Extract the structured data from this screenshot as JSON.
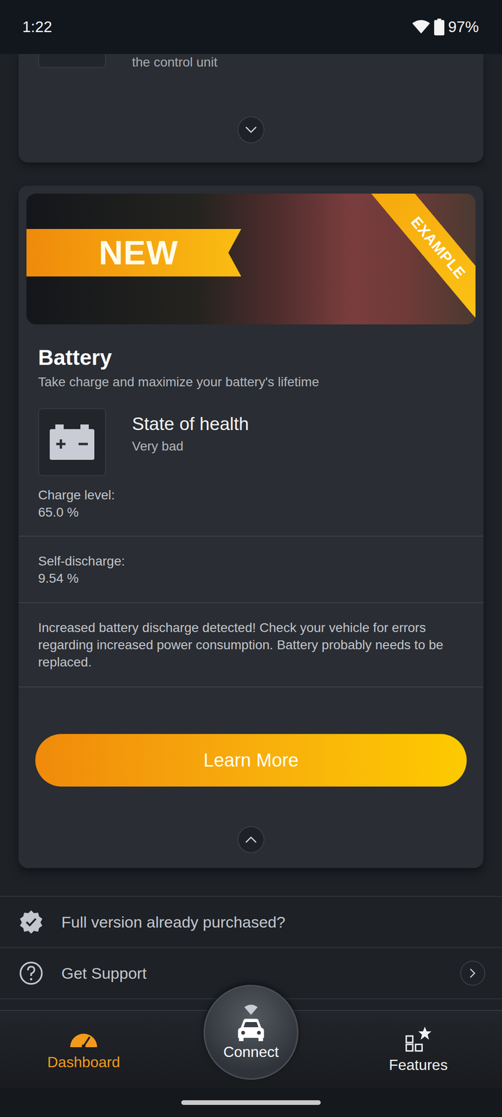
{
  "status_bar": {
    "time": "1:22",
    "battery": "97%",
    "battery_level": 0.97
  },
  "previous_card": {
    "text": "the control unit",
    "expanded": false
  },
  "battery_card": {
    "banner_badge": "NEW",
    "banner_corner": "EXAMPLE",
    "title": "Battery",
    "subtitle": "Take charge and maximize your battery's lifetime",
    "health_label": "State of health",
    "health_value": "Very bad",
    "charge": {
      "label": "Charge level:",
      "value": "65.0 %"
    },
    "self_discharge": {
      "label": "Self-discharge:",
      "value": "9.54 %"
    },
    "warning": "Increased battery discharge detected! Check your vehicle for errors regarding increased power consumption. Battery probably needs to be replaced.",
    "button": "Learn More",
    "expanded": true
  },
  "links": [
    {
      "label": "Full version already purchased?",
      "kind": "verified",
      "arrow": false
    },
    {
      "label": "Get Support",
      "kind": "help",
      "arrow": true
    }
  ],
  "nav": [
    {
      "label": "Dashboard",
      "kind": "dashboard",
      "selected": true
    },
    {
      "label": "Connect",
      "kind": "connect",
      "selected": false
    },
    {
      "label": "Features",
      "kind": "features",
      "selected": false
    }
  ]
}
